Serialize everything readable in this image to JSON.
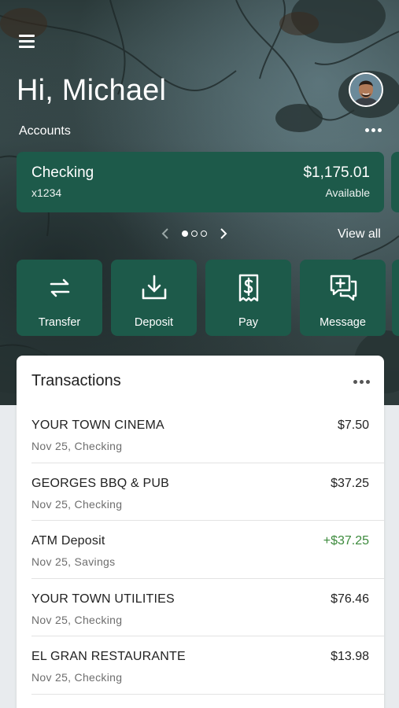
{
  "header": {
    "greeting": "Hi, Michael"
  },
  "accounts": {
    "label": "Accounts",
    "card": {
      "name": "Checking",
      "number": "x1234",
      "balance": "$1,175.01",
      "balance_label": "Available"
    },
    "pager": {
      "pages": 3,
      "current": 1
    },
    "view_all": "View all"
  },
  "actions": [
    {
      "label": "Transfer",
      "icon": "transfer-icon"
    },
    {
      "label": "Deposit",
      "icon": "deposit-icon"
    },
    {
      "label": "Pay",
      "icon": "pay-icon"
    },
    {
      "label": "Message",
      "icon": "message-icon"
    }
  ],
  "transactions": {
    "title": "Transactions",
    "items": [
      {
        "name": "YOUR TOWN CINEMA",
        "meta": "Nov 25, Checking",
        "amount": "$7.50",
        "credit": false
      },
      {
        "name": "GEORGES BBQ & PUB",
        "meta": "Nov 25, Checking",
        "amount": "$37.25",
        "credit": false
      },
      {
        "name": "ATM Deposit",
        "meta": "Nov 25, Savings",
        "amount": "+$37.25",
        "credit": true
      },
      {
        "name": "YOUR TOWN UTILITIES",
        "meta": "Nov 25, Checking",
        "amount": "$76.46",
        "credit": false
      },
      {
        "name": "EL GRAN RESTAURANTE",
        "meta": "Nov 25, Checking",
        "amount": "$13.98",
        "credit": false
      }
    ]
  },
  "colors": {
    "card": "#1d5a4a",
    "credit": "#3c8a3c"
  }
}
